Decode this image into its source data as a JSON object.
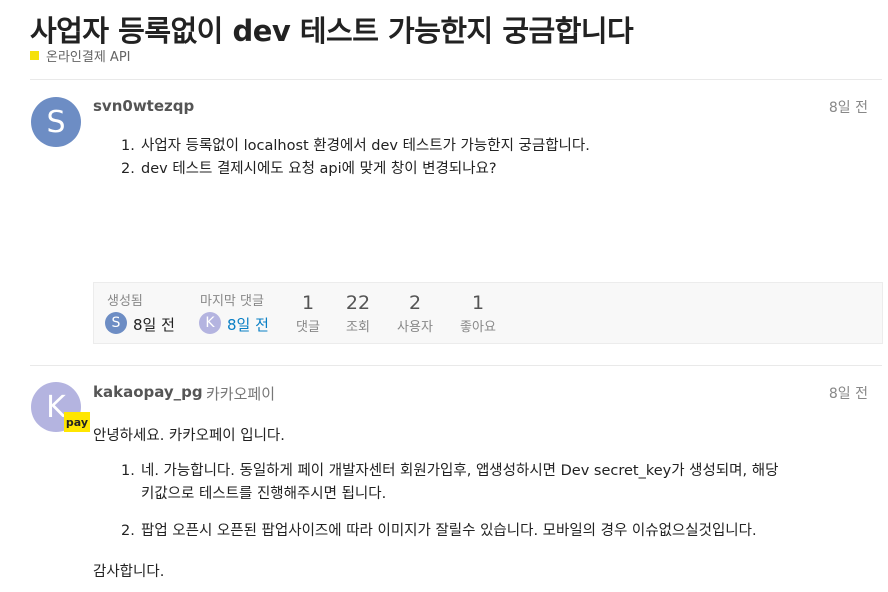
{
  "topic": {
    "title": "사업자 등록없이 dev 테스트 가능한지 궁금합니다",
    "category": "온라인결제 API",
    "category_color": "#f5e10a"
  },
  "post1": {
    "avatar_letter": "S",
    "avatar_color": "#6d8dc4",
    "username": "svn0wtezqp",
    "date": "8일 전",
    "items": [
      {
        "num": "1.",
        "text": "사업자 등록없이 localhost 환경에서 dev 테스트가 가능한지 궁금합니다."
      },
      {
        "num": "2.",
        "text": "dev 테스트 결제시에도 요청 api에 맞게 창이 변경되나요?"
      }
    ]
  },
  "meta": {
    "created_label": "생성됨",
    "created_avatar": "S",
    "created_date": "8일 전",
    "last_reply_label": "마지막 댓글",
    "last_reply_avatar": "K",
    "last_reply_date": "8일 전",
    "stats": [
      {
        "value": "1",
        "label": "댓글"
      },
      {
        "value": "22",
        "label": "조회"
      },
      {
        "value": "2",
        "label": "사용자"
      },
      {
        "value": "1",
        "label": "좋아요"
      }
    ]
  },
  "post2": {
    "avatar_letter": "K",
    "avatar_color": "#b4b4e0",
    "badge": "pay",
    "username": "kakaopay_pg",
    "fullname": "카카오페이",
    "date": "8일 전",
    "greeting": "안녕하세요. 카카오페이 입니다.",
    "items": [
      {
        "num": "1.",
        "line1": "네. 가능합니다. 동일하게 페이 개발자센터 회원가입후, 앱생성하시면 Dev secret_key가 생성되며, 해당",
        "line2": "키값으로 테스트를 진행해주시면 됩니다."
      },
      {
        "num": "2.",
        "line1": "팝업 오픈시 오픈된 팝업사이즈에 따라 이미지가 잘릴수 있습니다. 모바일의 경우 이슈없으실것입니다."
      }
    ],
    "closing": "감사합니다."
  }
}
